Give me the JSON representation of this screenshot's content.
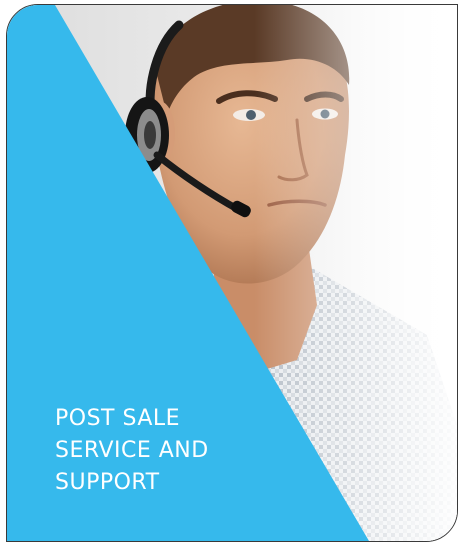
{
  "card": {
    "title_lines": [
      "POST SALE",
      "SERVICE AND",
      "SUPPORT"
    ]
  },
  "colors": {
    "panel": "#36b9ec",
    "border": "#3a3a3a",
    "text": "#ffffff"
  },
  "icons": {
    "photo": "man-with-headset-photo"
  }
}
